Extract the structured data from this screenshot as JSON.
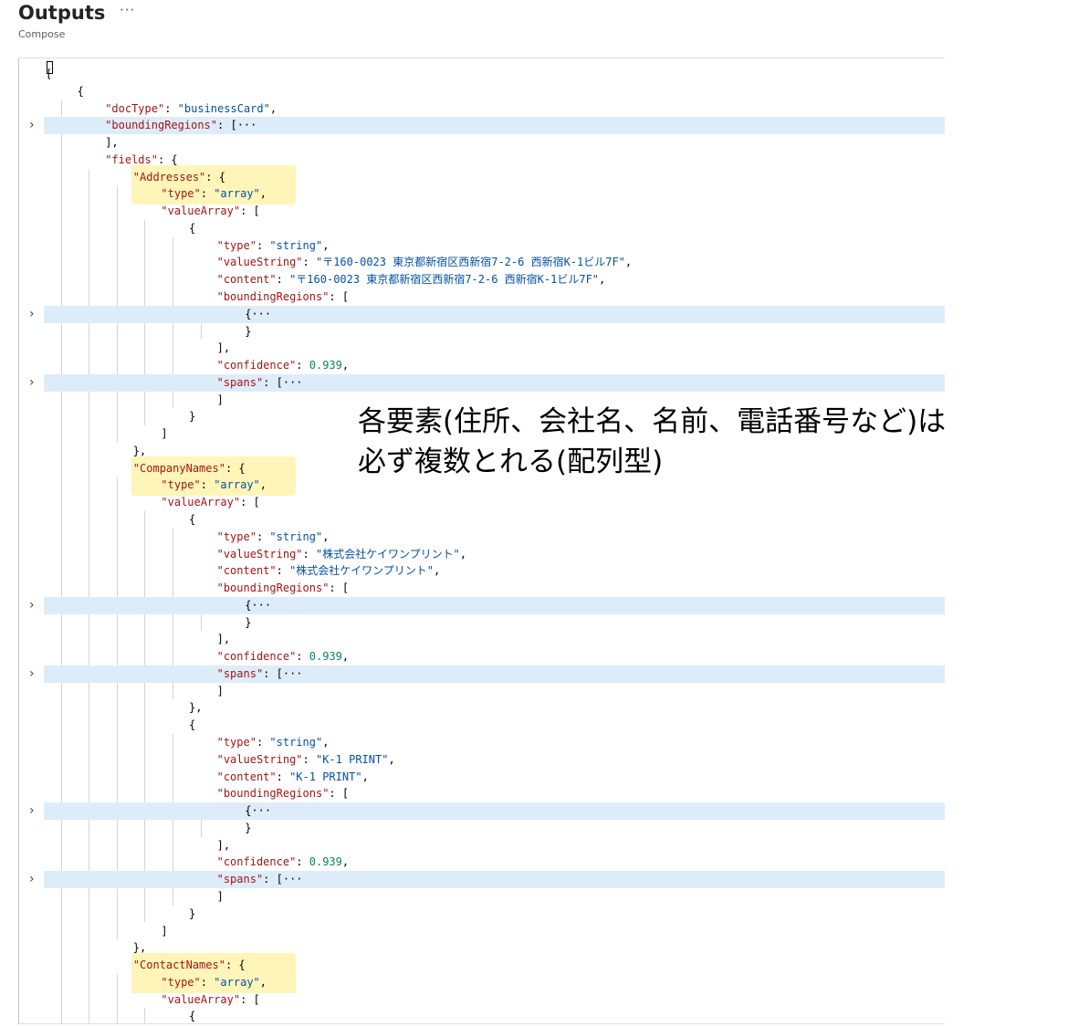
{
  "header": {
    "title": "Outputs",
    "more_label": "···",
    "subtitle": "Compose"
  },
  "annotation": {
    "line1": "各要素(住所、会社名、名前、電話番号など)は",
    "line2": "必ず複数とれる(配列型)"
  },
  "editor": {
    "lines": [
      {
        "indent": 0,
        "tokens": [
          [
            "p",
            "["
          ]
        ]
      },
      {
        "indent": 1,
        "tokens": [
          [
            "p",
            "{"
          ]
        ]
      },
      {
        "indent": 2,
        "tokens": [
          [
            "k",
            "\"docType\""
          ],
          [
            "p",
            ": "
          ],
          [
            "s",
            "\"businessCard\""
          ],
          [
            "p",
            ","
          ]
        ]
      },
      {
        "indent": 2,
        "fold": true,
        "tokens": [
          [
            "k",
            "\"boundingRegions\""
          ],
          [
            "p",
            ": [···"
          ]
        ]
      },
      {
        "indent": 2,
        "tokens": [
          [
            "p",
            "],"
          ]
        ]
      },
      {
        "indent": 2,
        "tokens": [
          [
            "k",
            "\"fields\""
          ],
          [
            "p",
            ": {"
          ]
        ]
      },
      {
        "indent": 3,
        "tokens": [
          [
            "k",
            "\"Addresses\""
          ],
          [
            "p",
            ": {"
          ]
        ]
      },
      {
        "indent": 4,
        "tokens": [
          [
            "k",
            "\"type\""
          ],
          [
            "p",
            ": "
          ],
          [
            "s",
            "\"array\""
          ],
          [
            "p",
            ","
          ]
        ]
      },
      {
        "indent": 4,
        "tokens": [
          [
            "k",
            "\"valueArray\""
          ],
          [
            "p",
            ": ["
          ]
        ]
      },
      {
        "indent": 5,
        "tokens": [
          [
            "p",
            "{"
          ]
        ]
      },
      {
        "indent": 6,
        "tokens": [
          [
            "k",
            "\"type\""
          ],
          [
            "p",
            ": "
          ],
          [
            "s",
            "\"string\""
          ],
          [
            "p",
            ","
          ]
        ]
      },
      {
        "indent": 6,
        "tokens": [
          [
            "k",
            "\"valueString\""
          ],
          [
            "p",
            ": "
          ],
          [
            "s",
            "\"〒160-0023 東京都新宿区西新宿7-2-6 西新宿K-1ビル7F\""
          ],
          [
            "p",
            ","
          ]
        ]
      },
      {
        "indent": 6,
        "tokens": [
          [
            "k",
            "\"content\""
          ],
          [
            "p",
            ": "
          ],
          [
            "s",
            "\"〒160-0023 東京都新宿区西新宿7-2-6 西新宿K-1ビル7F\""
          ],
          [
            "p",
            ","
          ]
        ]
      },
      {
        "indent": 6,
        "tokens": [
          [
            "k",
            "\"boundingRegions\""
          ],
          [
            "p",
            ": ["
          ]
        ]
      },
      {
        "indent": 7,
        "fold": true,
        "tokens": [
          [
            "p",
            "{···"
          ]
        ]
      },
      {
        "indent": 7,
        "tokens": [
          [
            "p",
            "}"
          ]
        ]
      },
      {
        "indent": 6,
        "tokens": [
          [
            "p",
            "],"
          ]
        ]
      },
      {
        "indent": 6,
        "tokens": [
          [
            "k",
            "\"confidence\""
          ],
          [
            "p",
            ": "
          ],
          [
            "n",
            "0.939"
          ],
          [
            "p",
            ","
          ]
        ]
      },
      {
        "indent": 6,
        "fold": true,
        "tokens": [
          [
            "k",
            "\"spans\""
          ],
          [
            "p",
            ": [···"
          ]
        ]
      },
      {
        "indent": 6,
        "tokens": [
          [
            "p",
            "]"
          ]
        ]
      },
      {
        "indent": 5,
        "tokens": [
          [
            "p",
            "}"
          ]
        ]
      },
      {
        "indent": 4,
        "tokens": [
          [
            "p",
            "]"
          ]
        ]
      },
      {
        "indent": 3,
        "tokens": [
          [
            "p",
            "},"
          ]
        ]
      },
      {
        "indent": 3,
        "tokens": [
          [
            "k",
            "\"CompanyNames\""
          ],
          [
            "p",
            ": {"
          ]
        ]
      },
      {
        "indent": 4,
        "tokens": [
          [
            "k",
            "\"type\""
          ],
          [
            "p",
            ": "
          ],
          [
            "s",
            "\"array\""
          ],
          [
            "p",
            ","
          ]
        ]
      },
      {
        "indent": 4,
        "tokens": [
          [
            "k",
            "\"valueArray\""
          ],
          [
            "p",
            ": ["
          ]
        ]
      },
      {
        "indent": 5,
        "tokens": [
          [
            "p",
            "{"
          ]
        ]
      },
      {
        "indent": 6,
        "tokens": [
          [
            "k",
            "\"type\""
          ],
          [
            "p",
            ": "
          ],
          [
            "s",
            "\"string\""
          ],
          [
            "p",
            ","
          ]
        ]
      },
      {
        "indent": 6,
        "tokens": [
          [
            "k",
            "\"valueString\""
          ],
          [
            "p",
            ": "
          ],
          [
            "s",
            "\"株式会社ケイワンプリント\""
          ],
          [
            "p",
            ","
          ]
        ]
      },
      {
        "indent": 6,
        "tokens": [
          [
            "k",
            "\"content\""
          ],
          [
            "p",
            ": "
          ],
          [
            "s",
            "\"株式会社ケイワンプリント\""
          ],
          [
            "p",
            ","
          ]
        ]
      },
      {
        "indent": 6,
        "tokens": [
          [
            "k",
            "\"boundingRegions\""
          ],
          [
            "p",
            ": ["
          ]
        ]
      },
      {
        "indent": 7,
        "fold": true,
        "tokens": [
          [
            "p",
            "{···"
          ]
        ]
      },
      {
        "indent": 7,
        "tokens": [
          [
            "p",
            "}"
          ]
        ]
      },
      {
        "indent": 6,
        "tokens": [
          [
            "p",
            "],"
          ]
        ]
      },
      {
        "indent": 6,
        "tokens": [
          [
            "k",
            "\"confidence\""
          ],
          [
            "p",
            ": "
          ],
          [
            "n",
            "0.939"
          ],
          [
            "p",
            ","
          ]
        ]
      },
      {
        "indent": 6,
        "fold": true,
        "tokens": [
          [
            "k",
            "\"spans\""
          ],
          [
            "p",
            ": [···"
          ]
        ]
      },
      {
        "indent": 6,
        "tokens": [
          [
            "p",
            "]"
          ]
        ]
      },
      {
        "indent": 5,
        "tokens": [
          [
            "p",
            "},"
          ]
        ]
      },
      {
        "indent": 5,
        "tokens": [
          [
            "p",
            "{"
          ]
        ]
      },
      {
        "indent": 6,
        "tokens": [
          [
            "k",
            "\"type\""
          ],
          [
            "p",
            ": "
          ],
          [
            "s",
            "\"string\""
          ],
          [
            "p",
            ","
          ]
        ]
      },
      {
        "indent": 6,
        "tokens": [
          [
            "k",
            "\"valueString\""
          ],
          [
            "p",
            ": "
          ],
          [
            "s",
            "\"K-1 PRINT\""
          ],
          [
            "p",
            ","
          ]
        ]
      },
      {
        "indent": 6,
        "tokens": [
          [
            "k",
            "\"content\""
          ],
          [
            "p",
            ": "
          ],
          [
            "s",
            "\"K-1 PRINT\""
          ],
          [
            "p",
            ","
          ]
        ]
      },
      {
        "indent": 6,
        "tokens": [
          [
            "k",
            "\"boundingRegions\""
          ],
          [
            "p",
            ": ["
          ]
        ]
      },
      {
        "indent": 7,
        "fold": true,
        "tokens": [
          [
            "p",
            "{···"
          ]
        ]
      },
      {
        "indent": 7,
        "tokens": [
          [
            "p",
            "}"
          ]
        ]
      },
      {
        "indent": 6,
        "tokens": [
          [
            "p",
            "],"
          ]
        ]
      },
      {
        "indent": 6,
        "tokens": [
          [
            "k",
            "\"confidence\""
          ],
          [
            "p",
            ": "
          ],
          [
            "n",
            "0.939"
          ],
          [
            "p",
            ","
          ]
        ]
      },
      {
        "indent": 6,
        "fold": true,
        "tokens": [
          [
            "k",
            "\"spans\""
          ],
          [
            "p",
            ": [···"
          ]
        ]
      },
      {
        "indent": 6,
        "tokens": [
          [
            "p",
            "]"
          ]
        ]
      },
      {
        "indent": 5,
        "tokens": [
          [
            "p",
            "}"
          ]
        ]
      },
      {
        "indent": 4,
        "tokens": [
          [
            "p",
            "]"
          ]
        ]
      },
      {
        "indent": 3,
        "tokens": [
          [
            "p",
            "},"
          ]
        ]
      },
      {
        "indent": 3,
        "tokens": [
          [
            "k",
            "\"ContactNames\""
          ],
          [
            "p",
            ": {"
          ]
        ]
      },
      {
        "indent": 4,
        "tokens": [
          [
            "k",
            "\"type\""
          ],
          [
            "p",
            ": "
          ],
          [
            "s",
            "\"array\""
          ],
          [
            "p",
            ","
          ]
        ]
      },
      {
        "indent": 4,
        "tokens": [
          [
            "k",
            "\"valueArray\""
          ],
          [
            "p",
            ": ["
          ]
        ]
      },
      {
        "indent": 5,
        "tokens": [
          [
            "p",
            "{"
          ]
        ]
      }
    ],
    "highlights": [
      {
        "start": 6,
        "end": 7
      },
      {
        "start": 23,
        "end": 24
      },
      {
        "start": 52,
        "end": 53
      }
    ]
  }
}
